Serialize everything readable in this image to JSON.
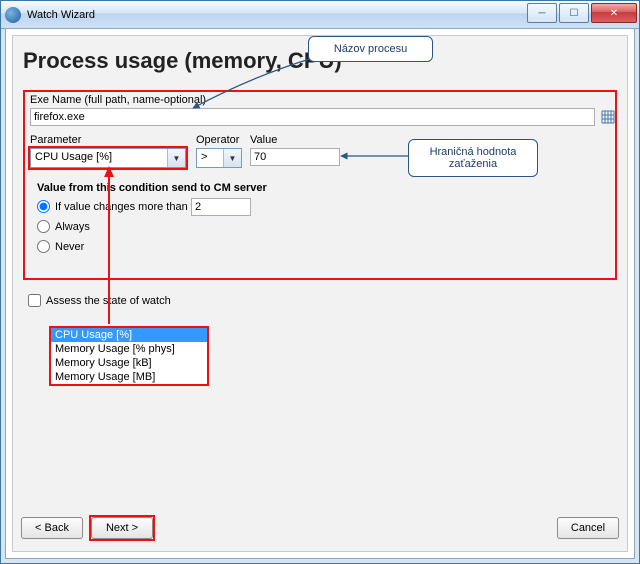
{
  "window": {
    "title": "Watch Wizard"
  },
  "heading": "Process usage (memory, CPU)",
  "callouts": {
    "name": "Názov procesu",
    "threshold_l1": "Hraničná hodnota",
    "threshold_l2": "zaťaženia"
  },
  "form": {
    "exe_label": "Exe Name (full path, name-optional)",
    "exe_value": "firefox.exe",
    "parameter_label": "Parameter",
    "parameter_value": "CPU Usage [%]",
    "operator_label": "Operator",
    "operator_value": ">",
    "value_label": "Value",
    "value_value": "70",
    "sendgroup_title": "Value from this condition send to CM server",
    "opt_change_label": "If value changes more than",
    "opt_change_value": "2",
    "opt_always": "Always",
    "opt_never": "Never",
    "assess_label": "Assess the state of watch"
  },
  "dropdown": {
    "items": [
      "CPU Usage [%]",
      "Memory Usage [% phys]",
      "Memory Usage [kB]",
      "Memory Usage [MB]"
    ],
    "selected_index": 0
  },
  "buttons": {
    "back": "< Back",
    "next": "Next >",
    "cancel": "Cancel"
  }
}
